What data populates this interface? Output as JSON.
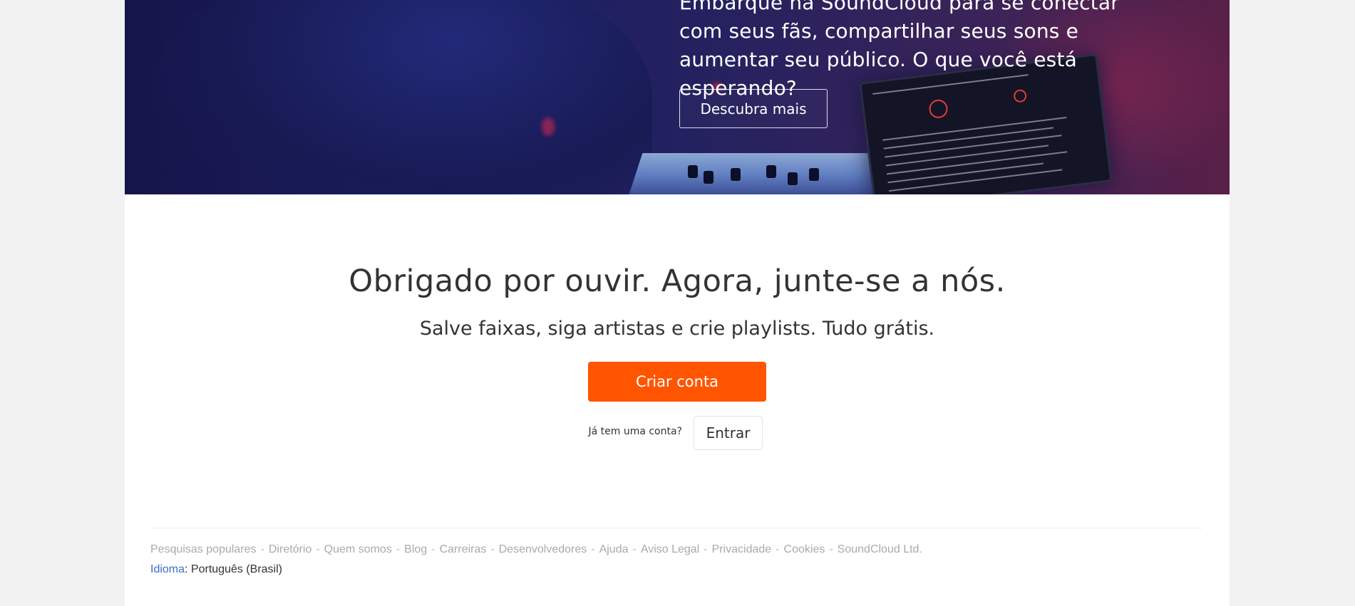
{
  "hero": {
    "text": "Embarque na SoundCloud para se conectar com seus fãs, compartilhar seus sons e aumentar seu público. O que você está esperando?",
    "button_label": "Descubra mais"
  },
  "signup": {
    "title": "Obrigado por ouvir. Agora, junte-se a nós.",
    "subtitle": "Salve faixas, siga artistas e crie playlists. Tudo grátis.",
    "create_account_label": "Criar conta",
    "have_account_text": "Já tem uma conta?",
    "sign_in_label": "Entrar"
  },
  "footer": {
    "links": [
      "Pesquisas populares",
      "Diretório",
      "Quem somos",
      "Blog",
      "Carreiras",
      "Desenvolvedores",
      "Ajuda",
      "Aviso Legal",
      "Privacidade",
      "Cookies",
      "SoundCloud Ltd."
    ],
    "separator": "-",
    "language_label": "Idioma",
    "language_colon": ":",
    "language_value": "Português (Brasil)"
  },
  "colors": {
    "brand_orange": "#ff5500",
    "language_link_blue": "#3a6fc4"
  }
}
